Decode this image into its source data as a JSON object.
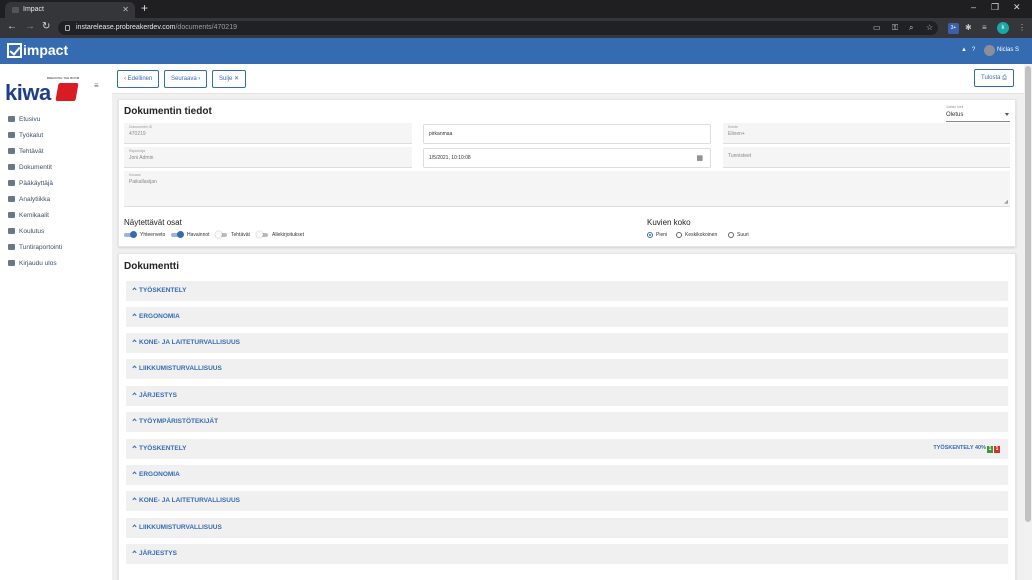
{
  "browser": {
    "tab_title": "Impact",
    "tab_close": "✕",
    "newtab": "+",
    "url_host": "instarelease.probreakerdev.com",
    "url_path": "/documents/470219",
    "profile_initial": "k",
    "ext_badge": "3+",
    "win_min": "–",
    "win_max": "❐",
    "win_close": "✕"
  },
  "appbar": {
    "logo_text": "impact",
    "user_name": "Niclas S"
  },
  "sidebar": {
    "brand_small": "BREAKING THE BOOM",
    "brand": "kiwa",
    "items": [
      {
        "label": "Etusivu",
        "icon": "home-icon"
      },
      {
        "label": "Työkalut",
        "icon": "wrench-icon"
      },
      {
        "label": "Tehtävät",
        "icon": "tasks-icon"
      },
      {
        "label": "Dokumentit",
        "icon": "folder-icon"
      },
      {
        "label": "Pääkäyttäjä",
        "icon": "admin-icon"
      },
      {
        "label": "Analytiikka",
        "icon": "analytics-icon"
      },
      {
        "label": "Kemikaalit",
        "icon": "flask-icon"
      },
      {
        "label": "Koulutus",
        "icon": "education-icon"
      },
      {
        "label": "Tuntiraportointi",
        "icon": "clock-icon"
      },
      {
        "label": "Kirjaudu ulos",
        "icon": "lock-icon"
      }
    ]
  },
  "toolbar": {
    "prev": "Edellinen",
    "next": "Seuraava",
    "close": "Sulje",
    "print": "Tulosta"
  },
  "doc_info": {
    "title": "Dokumentin tiedot",
    "language_label": "Valitse kieli",
    "language_value": "Oletus",
    "fields": {
      "doc_id_label": "Dokumentin ID",
      "doc_id": "470219",
      "place": "pirkanmaa",
      "photo_label": "Kohde",
      "photo_value": "Elinen+",
      "reporter_label": "Raportoija",
      "reporter": "Joni Admin",
      "datetime": "1/5/2021, 10:10:08",
      "other_label": "Tunnisteet",
      "desc_label": "Kuvaus",
      "desc_placeholder": "Paikallasijan"
    },
    "visible_parts_title": "Näytettävät osat",
    "toggles": [
      {
        "label": "Yhteenveto",
        "on": true
      },
      {
        "label": "Havainnot",
        "on": true
      },
      {
        "label": "Tehtävät",
        "on": false
      },
      {
        "label": "Allekirjoitukset",
        "on": false
      }
    ],
    "image_size_title": "Kuvien koko",
    "radios": [
      {
        "label": "Pieni",
        "selected": true
      },
      {
        "label": "Keskikokoinen",
        "selected": false
      },
      {
        "label": "Suuri",
        "selected": false
      }
    ]
  },
  "document": {
    "title": "Dokumentti",
    "sections": [
      "TYÖSKENTELY",
      "ERGONOMIA",
      "KONE- JA LAITETURVALLISUUS",
      "LIIKKUMISTURVALLISUUS",
      "JÄRJESTYS",
      "TYÖYMPÄRISTÖTEKIJÄT",
      "TYÖSKENTELY",
      "ERGONOMIA",
      "KONE- JA LAITETURVALLISUUS",
      "LIIKKUMISTURVALLISUUS",
      "JÄRJESTYS"
    ],
    "status": {
      "label": "TYÖSKENTELY",
      "percent": "40%",
      "green": "1",
      "red": "1"
    }
  }
}
